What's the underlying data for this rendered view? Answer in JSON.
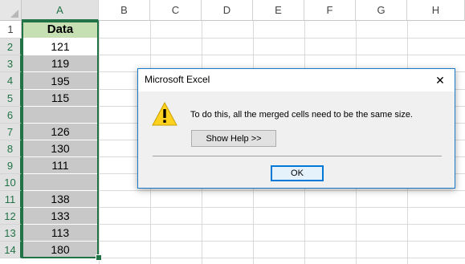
{
  "sheet": {
    "columns": [
      "A",
      "B",
      "C",
      "D",
      "E",
      "F",
      "G",
      "H"
    ],
    "rows": [
      "1",
      "2",
      "3",
      "4",
      "5",
      "6",
      "7",
      "8",
      "9",
      "10",
      "11",
      "12",
      "13",
      "14"
    ],
    "colA": {
      "header": "Data",
      "values": [
        "121",
        "119",
        "195",
        "115",
        "",
        "126",
        "130",
        "111",
        "",
        "138",
        "133",
        "113",
        "180"
      ]
    }
  },
  "dialog": {
    "title": "Microsoft Excel",
    "message": "To do this, all the merged cells need to be the same size.",
    "help_button": "Show Help >>",
    "ok_button": "OK",
    "close_glyph": "✕",
    "icon": "warning-icon",
    "accent": "#1979ca"
  },
  "colors": {
    "selection": "#217346",
    "header_fill": "#c6e0b4",
    "cell_fill": "#c8c8c8"
  }
}
